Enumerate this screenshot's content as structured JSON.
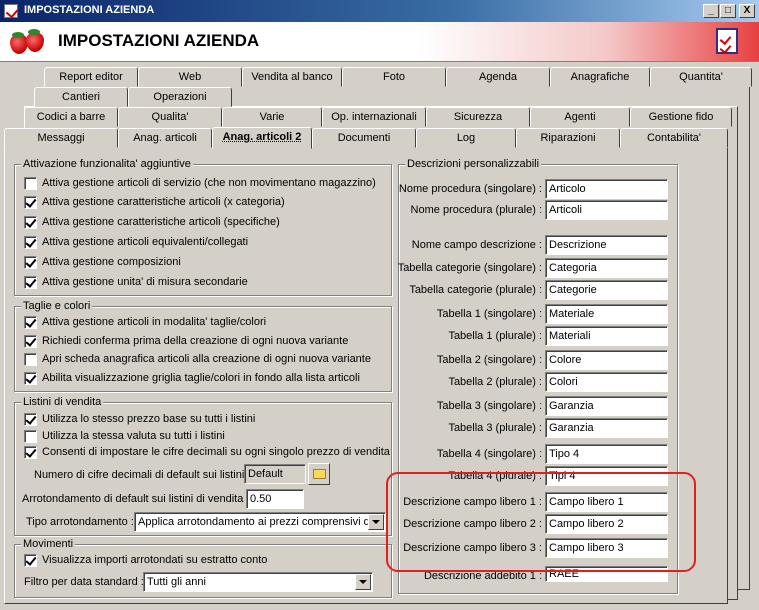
{
  "window": {
    "title": "IMPOSTAZIONI AZIENDA",
    "minimize": "_",
    "maximize": "□",
    "close": "X"
  },
  "header": {
    "title": "IMPOSTAZIONI AZIENDA"
  },
  "tabs": {
    "row1": [
      "Report editor",
      "Web",
      "Vendita al banco",
      "Foto",
      "Agenda",
      "Anagrafiche",
      "Quantita'"
    ],
    "row2": [
      "Cantieri",
      "Operazioni"
    ],
    "row3": [
      "Codici a barre",
      "Qualita'",
      "Varie",
      "Op. internazionali",
      "Sicurezza",
      "Agenti",
      "Gestione fido"
    ],
    "row4": [
      "Messaggi",
      "Anag. articoli",
      "Anag. articoli 2",
      "Documenti",
      "Log",
      "Riparazioni",
      "Contabilita'"
    ]
  },
  "attivazione": {
    "title": "Attivazione funzionalita' aggiuntive",
    "items": [
      {
        "label": "Attiva gestione articoli di servizio (che non movimentano magazzino)",
        "checked": false
      },
      {
        "label": "Attiva gestione caratteristiche articoli (x categoria)",
        "checked": true
      },
      {
        "label": "Attiva gestione caratteristiche articoli (specifiche)",
        "checked": true
      },
      {
        "label": "Attiva gestione articoli equivalenti/collegati",
        "checked": true
      },
      {
        "label": "Attiva gestione composizioni",
        "checked": true
      },
      {
        "label": "Attiva gestione unita' di misura secondarie",
        "checked": true
      }
    ]
  },
  "taglie": {
    "title": "Taglie e colori",
    "items": [
      {
        "label": "Attiva gestione articoli in modalita' taglie/colori",
        "checked": true
      },
      {
        "label": "Richiedi conferma prima della creazione di ogni nuova variante",
        "checked": true
      },
      {
        "label": "Apri scheda anagrafica articoli alla creazione di ogni nuova variante",
        "checked": false
      },
      {
        "label": "Abilita visualizzazione griglia taglie/colori in fondo alla lista articoli",
        "checked": true
      }
    ]
  },
  "listini": {
    "title": "Listini di vendita",
    "items": [
      {
        "label": "Utilizza lo stesso prezzo base su tutti i listini",
        "checked": true
      },
      {
        "label": "Utilizza la stessa valuta su tutti i listini",
        "checked": false
      },
      {
        "label": "Consenti di impostare le cifre decimali su ogni singolo prezzo di vendita",
        "checked": true
      }
    ],
    "decimali_label": "Numero di cifre decimali di default sui listini :",
    "decimali_value": "Default",
    "arrotondamento_label": "Arrotondamento di default sui listini di vendita :",
    "arrotondamento_value": "0.50",
    "tipo_label": "Tipo arrotondamento :",
    "tipo_value": "Applica arrotondamento ai prezzi comprensivi di i"
  },
  "movimenti": {
    "title": "Movimenti",
    "items": [
      {
        "label": "Visualizza importi arrotondati su estratto conto",
        "checked": true
      }
    ],
    "filtro_label": "Filtro per data standard :",
    "filtro_value": "Tutti gli anni"
  },
  "descrizioni": {
    "title": "Descrizioni personalizzabili",
    "fields": [
      {
        "label": "Nome procedura (singolare) :",
        "value": "Articolo"
      },
      {
        "label": "Nome procedura (plurale) :",
        "value": "Articoli"
      },
      {
        "label": "Nome campo descrizione :",
        "value": "Descrizione"
      },
      {
        "label": "Tabella categorie (singolare) :",
        "value": "Categoria"
      },
      {
        "label": "Tabella categorie (plurale) :",
        "value": "Categorie"
      },
      {
        "label": "Tabella 1 (singolare) :",
        "value": "Materiale"
      },
      {
        "label": "Tabella 1 (plurale) :",
        "value": "Materiali"
      },
      {
        "label": "Tabella 2 (singolare) :",
        "value": "Colore"
      },
      {
        "label": "Tabella 2 (plurale) :",
        "value": "Colori"
      },
      {
        "label": "Tabella 3 (singolare) :",
        "value": "Garanzia"
      },
      {
        "label": "Tabella 3 (plurale) :",
        "value": "Garanzia"
      },
      {
        "label": "Tabella 4 (singolare) :",
        "value": "Tipo 4"
      },
      {
        "label": "Tabella 4 (plurale) :",
        "value": "Tipi 4"
      },
      {
        "label": "Descrizione campo libero 1 :",
        "value": "Campo libero 1"
      },
      {
        "label": "Descrizione campo libero 2 :",
        "value": "Campo libero 2"
      },
      {
        "label": "Descrizione campo libero 3 :",
        "value": "Campo libero 3"
      },
      {
        "label": "Descrizione addebito 1 :",
        "value": "RAEE"
      }
    ]
  },
  "colors": {
    "highlight": "#e02020",
    "titlebar": "#0a246a",
    "face": "#d4d0c8"
  }
}
